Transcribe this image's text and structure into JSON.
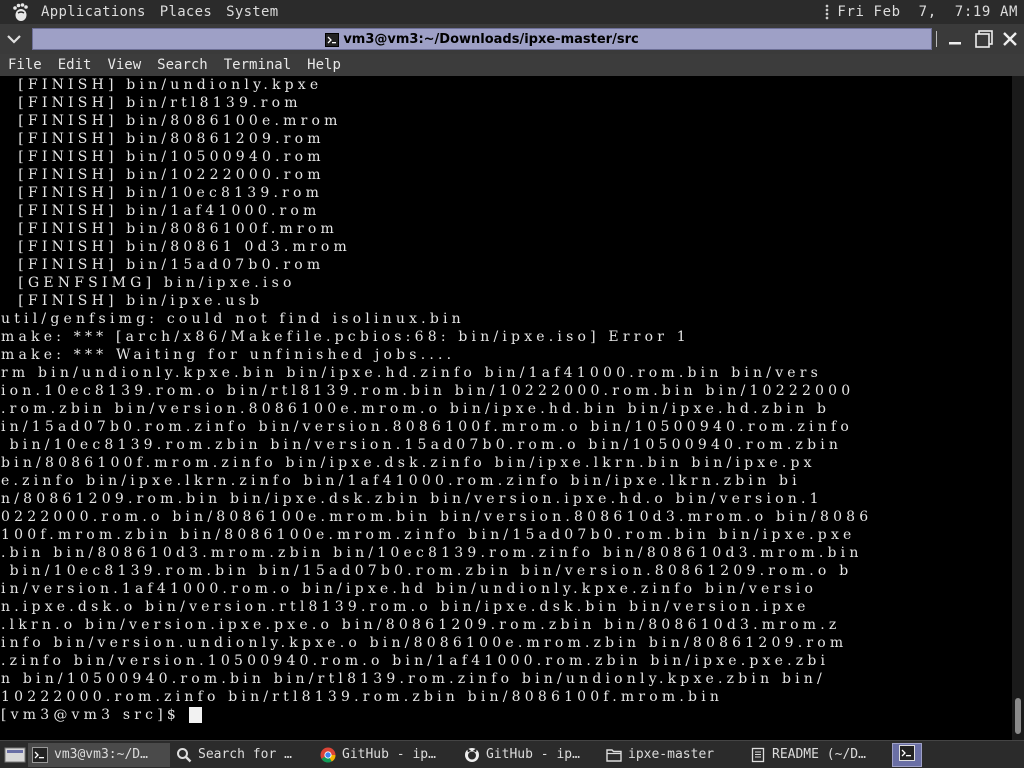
{
  "top_panel": {
    "menus": [
      "Applications",
      "Places",
      "System"
    ],
    "clock": "Fri Feb  7,  7:19 AM",
    "logo_icon": "gnome-foot-icon"
  },
  "window": {
    "title": "vm3@vm3:~/Downloads/ipxe-master/src",
    "title_icon": "terminal-icon",
    "buttons": {
      "minimize": "minimize-icon",
      "maximize": "maximize-icon",
      "close": "close-icon"
    }
  },
  "menubar": {
    "items": [
      "File",
      "Edit",
      "View",
      "Search",
      "Terminal",
      "Help"
    ]
  },
  "terminal": {
    "lines": [
      "  [FINISH] bin/undionly.kpxe",
      "  [FINISH] bin/rtl8139.rom",
      "  [FINISH] bin/8086100e.mrom",
      "  [FINISH] bin/80861209.rom",
      "  [FINISH] bin/10500940.rom",
      "  [FINISH] bin/10222000.rom",
      "  [FINISH] bin/10ec8139.rom",
      "  [FINISH] bin/1af41000.rom",
      "  [FINISH] bin/8086100f.mrom",
      "  [FINISH] bin/80861 0d3.mrom",
      "  [FINISH] bin/15ad07b0.rom",
      "  [GENFSIMG] bin/ipxe.iso",
      "  [FINISH] bin/ipxe.usb",
      "util/genfsimg: could not find isolinux.bin",
      "make: *** [arch/x86/Makefile.pcbios:68: bin/ipxe.iso] Error 1",
      "make: *** Waiting for unfinished jobs....",
      "rm bin/undionly.kpxe.bin bin/ipxe.hd.zinfo bin/1af41000.rom.bin bin/vers",
      "ion.10ec8139.rom.o bin/rtl8139.rom.bin bin/10222000.rom.bin bin/10222000",
      ".rom.zbin bin/version.8086100e.mrom.o bin/ipxe.hd.bin bin/ipxe.hd.zbin b",
      "in/15ad07b0.rom.zinfo bin/version.8086100f.mrom.o bin/10500940.rom.zinfo",
      " bin/10ec8139.rom.zbin bin/version.15ad07b0.rom.o bin/10500940.rom.zbin",
      "bin/8086100f.mrom.zinfo bin/ipxe.dsk.zinfo bin/ipxe.lkrn.bin bin/ipxe.px",
      "e.zinfo bin/ipxe.lkrn.zinfo bin/1af41000.rom.zinfo bin/ipxe.lkrn.zbin bi",
      "n/80861209.rom.bin bin/ipxe.dsk.zbin bin/version.ipxe.hd.o bin/version.1",
      "0222000.rom.o bin/8086100e.mrom.bin bin/version.808610d3.mrom.o bin/8086",
      "100f.mrom.zbin bin/8086100e.mrom.zinfo bin/15ad07b0.rom.bin bin/ipxe.pxe",
      ".bin bin/808610d3.mrom.zbin bin/10ec8139.rom.zinfo bin/808610d3.mrom.bin",
      " bin/10ec8139.rom.bin bin/15ad07b0.rom.zbin bin/version.80861209.rom.o b",
      "in/version.1af41000.rom.o bin/ipxe.hd bin/undionly.kpxe.zinfo bin/versio",
      "n.ipxe.dsk.o bin/version.rtl8139.rom.o bin/ipxe.dsk.bin bin/version.ipxe",
      ".lkrn.o bin/version.ipxe.pxe.o bin/80861209.rom.zbin bin/808610d3.mrom.z",
      "info bin/version.undionly.kpxe.o bin/8086100e.mrom.zbin bin/80861209.rom",
      ".zinfo bin/version.10500940.rom.o bin/1af41000.rom.zbin bin/ipxe.pxe.zbi",
      "n bin/10500940.rom.bin bin/rtl8139.rom.zinfo bin/undionly.kpxe.zbin bin/",
      "10222000.rom.zinfo bin/rtl8139.rom.zbin bin/8086100f.mrom.bin"
    ],
    "prompt": "[vm3@vm3 src]$ "
  },
  "taskbar": {
    "show_desktop_icon": "show-desktop-icon",
    "tasks": [
      {
        "icon": "terminal-icon",
        "label": "vm3@vm3:~/D…"
      },
      {
        "icon": "search-icon",
        "label": "Search for …"
      },
      {
        "icon": "chrome-icon",
        "label": "GitHub - ip…"
      },
      {
        "icon": "github-icon",
        "label": "GitHub - ip…"
      },
      {
        "icon": "folder-icon",
        "label": "ipxe-master"
      },
      {
        "icon": "document-icon",
        "label": "README (~/D…"
      }
    ],
    "last_icon": "terminal-icon"
  },
  "colors": {
    "panel_bg": "#2b2b2b",
    "title_field_bg": "#9ea0c6",
    "terminal_bg": "#000000",
    "terminal_fg": "#e6e6e6"
  }
}
